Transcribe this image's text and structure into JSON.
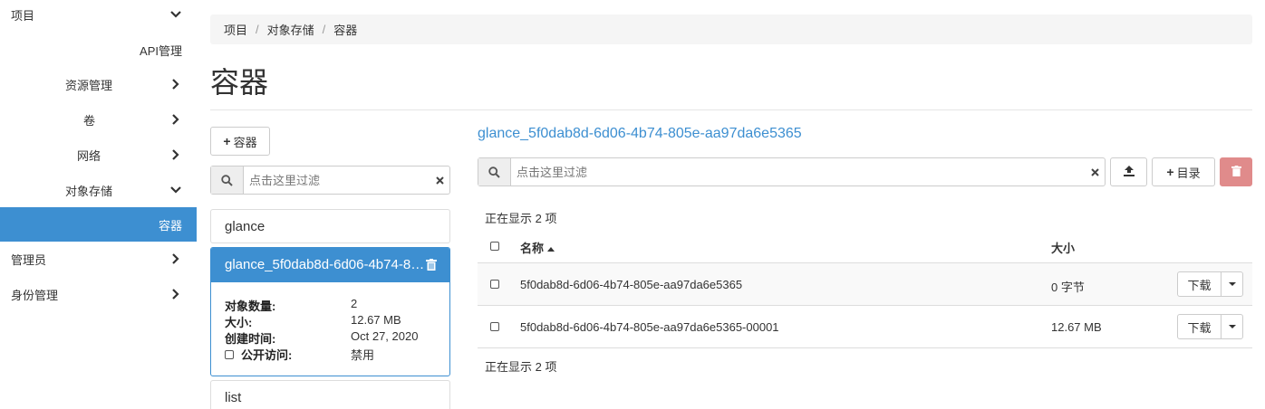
{
  "sidebar": {
    "project": "项目",
    "api": "API管理",
    "resources": "资源管理",
    "volumes": "卷",
    "network": "网络",
    "object_storage": "对象存储",
    "containers": "容器",
    "admin": "管理员",
    "identity": "身份管理"
  },
  "breadcrumb": [
    "项目",
    "对象存储",
    "容器"
  ],
  "page_title": "容器",
  "left": {
    "add_container_label": "容器",
    "filter_placeholder": "点击这里过滤",
    "containers": [
      {
        "name": "glance"
      },
      {
        "name": "glance_5f0dab8d-6d06-4b74-805e-aa97da6e5365"
      },
      {
        "name": "list"
      }
    ],
    "details": {
      "count_label": "对象数量:",
      "count": "2",
      "size_label": "大小:",
      "size": "12.67 MB",
      "created_label": "创建时间:",
      "created": "Oct 27, 2020",
      "public_label": "公开访问:",
      "public": "禁用"
    }
  },
  "right": {
    "title": "glance_5f0dab8d-6d06-4b74-805e-aa97da6e5365",
    "filter_placeholder": "点击这里过滤",
    "folder_label": "目录",
    "showing": "正在显示 2 项",
    "col_name": "名称",
    "col_size": "大小",
    "rows": [
      {
        "name": "5f0dab8d-6d06-4b74-805e-aa97da6e5365",
        "size": "0 字节",
        "action": "下载"
      },
      {
        "name": "5f0dab8d-6d06-4b74-805e-aa97da6e5365-00001",
        "size": "12.67 MB",
        "action": "下载"
      }
    ]
  },
  "colors": {
    "accent": "#3d8fd1",
    "danger": "#e08b8b"
  }
}
